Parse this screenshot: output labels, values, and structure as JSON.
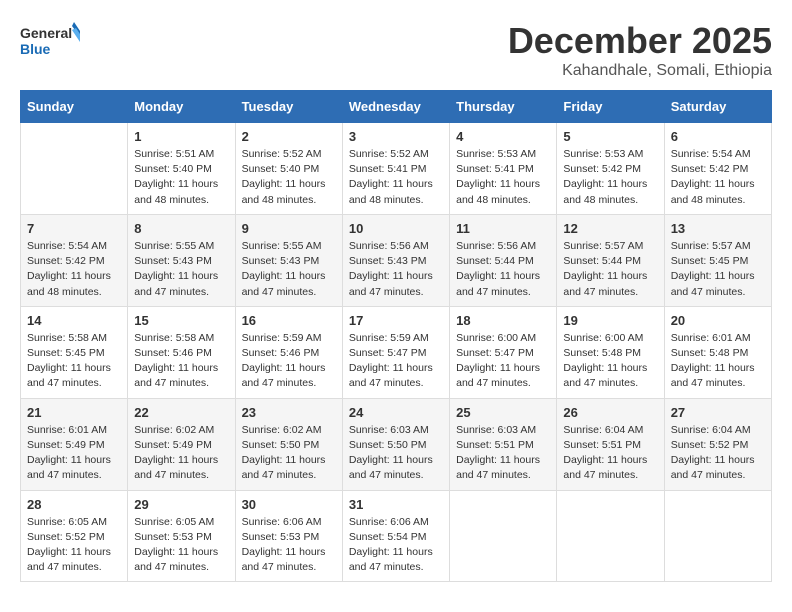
{
  "logo": {
    "general": "General",
    "blue": "Blue"
  },
  "title": "December 2025",
  "subtitle": "Kahandhale, Somali, Ethiopia",
  "days_of_week": [
    "Sunday",
    "Monday",
    "Tuesday",
    "Wednesday",
    "Thursday",
    "Friday",
    "Saturday"
  ],
  "weeks": [
    [
      {
        "day": "",
        "info": ""
      },
      {
        "day": "1",
        "info": "Sunrise: 5:51 AM\nSunset: 5:40 PM\nDaylight: 11 hours\nand 48 minutes."
      },
      {
        "day": "2",
        "info": "Sunrise: 5:52 AM\nSunset: 5:40 PM\nDaylight: 11 hours\nand 48 minutes."
      },
      {
        "day": "3",
        "info": "Sunrise: 5:52 AM\nSunset: 5:41 PM\nDaylight: 11 hours\nand 48 minutes."
      },
      {
        "day": "4",
        "info": "Sunrise: 5:53 AM\nSunset: 5:41 PM\nDaylight: 11 hours\nand 48 minutes."
      },
      {
        "day": "5",
        "info": "Sunrise: 5:53 AM\nSunset: 5:42 PM\nDaylight: 11 hours\nand 48 minutes."
      },
      {
        "day": "6",
        "info": "Sunrise: 5:54 AM\nSunset: 5:42 PM\nDaylight: 11 hours\nand 48 minutes."
      }
    ],
    [
      {
        "day": "7",
        "info": "Sunrise: 5:54 AM\nSunset: 5:42 PM\nDaylight: 11 hours\nand 48 minutes."
      },
      {
        "day": "8",
        "info": "Sunrise: 5:55 AM\nSunset: 5:43 PM\nDaylight: 11 hours\nand 47 minutes."
      },
      {
        "day": "9",
        "info": "Sunrise: 5:55 AM\nSunset: 5:43 PM\nDaylight: 11 hours\nand 47 minutes."
      },
      {
        "day": "10",
        "info": "Sunrise: 5:56 AM\nSunset: 5:43 PM\nDaylight: 11 hours\nand 47 minutes."
      },
      {
        "day": "11",
        "info": "Sunrise: 5:56 AM\nSunset: 5:44 PM\nDaylight: 11 hours\nand 47 minutes."
      },
      {
        "day": "12",
        "info": "Sunrise: 5:57 AM\nSunset: 5:44 PM\nDaylight: 11 hours\nand 47 minutes."
      },
      {
        "day": "13",
        "info": "Sunrise: 5:57 AM\nSunset: 5:45 PM\nDaylight: 11 hours\nand 47 minutes."
      }
    ],
    [
      {
        "day": "14",
        "info": "Sunrise: 5:58 AM\nSunset: 5:45 PM\nDaylight: 11 hours\nand 47 minutes."
      },
      {
        "day": "15",
        "info": "Sunrise: 5:58 AM\nSunset: 5:46 PM\nDaylight: 11 hours\nand 47 minutes."
      },
      {
        "day": "16",
        "info": "Sunrise: 5:59 AM\nSunset: 5:46 PM\nDaylight: 11 hours\nand 47 minutes."
      },
      {
        "day": "17",
        "info": "Sunrise: 5:59 AM\nSunset: 5:47 PM\nDaylight: 11 hours\nand 47 minutes."
      },
      {
        "day": "18",
        "info": "Sunrise: 6:00 AM\nSunset: 5:47 PM\nDaylight: 11 hours\nand 47 minutes."
      },
      {
        "day": "19",
        "info": "Sunrise: 6:00 AM\nSunset: 5:48 PM\nDaylight: 11 hours\nand 47 minutes."
      },
      {
        "day": "20",
        "info": "Sunrise: 6:01 AM\nSunset: 5:48 PM\nDaylight: 11 hours\nand 47 minutes."
      }
    ],
    [
      {
        "day": "21",
        "info": "Sunrise: 6:01 AM\nSunset: 5:49 PM\nDaylight: 11 hours\nand 47 minutes."
      },
      {
        "day": "22",
        "info": "Sunrise: 6:02 AM\nSunset: 5:49 PM\nDaylight: 11 hours\nand 47 minutes."
      },
      {
        "day": "23",
        "info": "Sunrise: 6:02 AM\nSunset: 5:50 PM\nDaylight: 11 hours\nand 47 minutes."
      },
      {
        "day": "24",
        "info": "Sunrise: 6:03 AM\nSunset: 5:50 PM\nDaylight: 11 hours\nand 47 minutes."
      },
      {
        "day": "25",
        "info": "Sunrise: 6:03 AM\nSunset: 5:51 PM\nDaylight: 11 hours\nand 47 minutes."
      },
      {
        "day": "26",
        "info": "Sunrise: 6:04 AM\nSunset: 5:51 PM\nDaylight: 11 hours\nand 47 minutes."
      },
      {
        "day": "27",
        "info": "Sunrise: 6:04 AM\nSunset: 5:52 PM\nDaylight: 11 hours\nand 47 minutes."
      }
    ],
    [
      {
        "day": "28",
        "info": "Sunrise: 6:05 AM\nSunset: 5:52 PM\nDaylight: 11 hours\nand 47 minutes."
      },
      {
        "day": "29",
        "info": "Sunrise: 6:05 AM\nSunset: 5:53 PM\nDaylight: 11 hours\nand 47 minutes."
      },
      {
        "day": "30",
        "info": "Sunrise: 6:06 AM\nSunset: 5:53 PM\nDaylight: 11 hours\nand 47 minutes."
      },
      {
        "day": "31",
        "info": "Sunrise: 6:06 AM\nSunset: 5:54 PM\nDaylight: 11 hours\nand 47 minutes."
      },
      {
        "day": "",
        "info": ""
      },
      {
        "day": "",
        "info": ""
      },
      {
        "day": "",
        "info": ""
      }
    ]
  ]
}
